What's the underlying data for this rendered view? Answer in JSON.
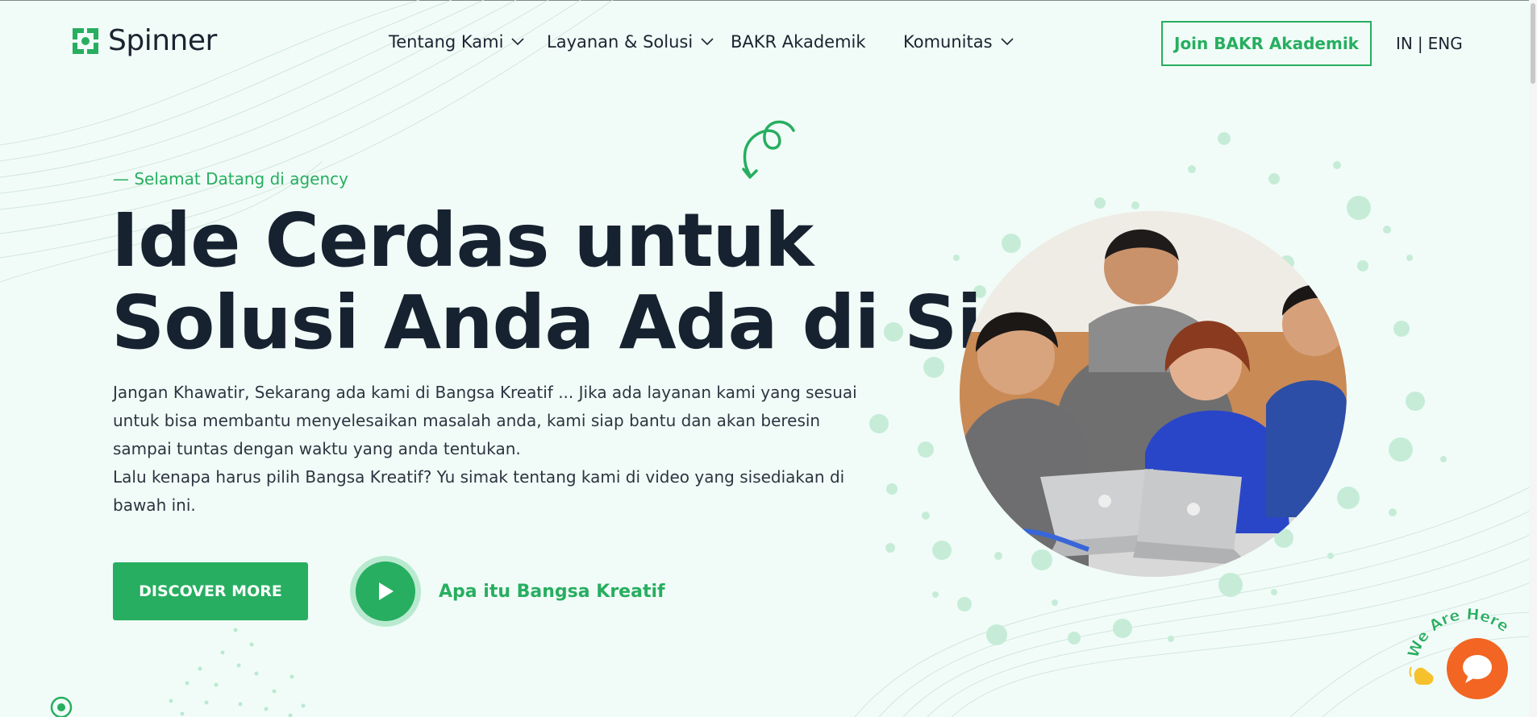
{
  "header": {
    "logo_text": "Spinner",
    "nav": [
      {
        "label": "Tentang Kami",
        "has_dropdown": true
      },
      {
        "label": "Layanan & Solusi",
        "has_dropdown": true
      },
      {
        "label": "BAKR Akademik",
        "has_dropdown": false
      },
      {
        "label": "Komunitas",
        "has_dropdown": true
      }
    ],
    "cta_label": "Join BAKR Akademik",
    "lang": {
      "in": "IN",
      "separator": "|",
      "eng": "ENG"
    }
  },
  "hero": {
    "eyebrow": "— Selamat Datang di agency",
    "title_line1": "Ide Cerdas untuk",
    "title_line2": "Solusi Anda Ada di Sini",
    "desc": [
      "Jangan Khawatir, Sekarang ada kami di Bangsa Kreatif ... Jika ada layanan kami yang sesuai",
      "untuk bisa membantu menyelesaikan masalah anda, kami siap bantu dan akan beresin",
      "sampai tuntas dengan waktu yang anda tentukan.",
      "Lalu kenapa harus pilih Bangsa Kreatif? Yu simak tentang kami di video yang sisediakan di",
      "bawah ini."
    ],
    "primary_button": "DISCOVER MORE",
    "video_label": "Apa itu Bangsa Kreatif"
  },
  "chat": {
    "badge_text": "We Are Here!"
  },
  "colors": {
    "accent": "#27ae60",
    "background": "#f1fcf8",
    "heading": "#162230",
    "chat": "#f26522"
  },
  "icons": {
    "logo": "spinner-logo-icon",
    "dropdown": "chevron-down-icon",
    "play": "play-icon",
    "chat": "chat-bubble-icon",
    "wave": "waving-hand-icon",
    "squiggle": "squiggle-arrow-icon",
    "location": "location-pin-icon"
  }
}
